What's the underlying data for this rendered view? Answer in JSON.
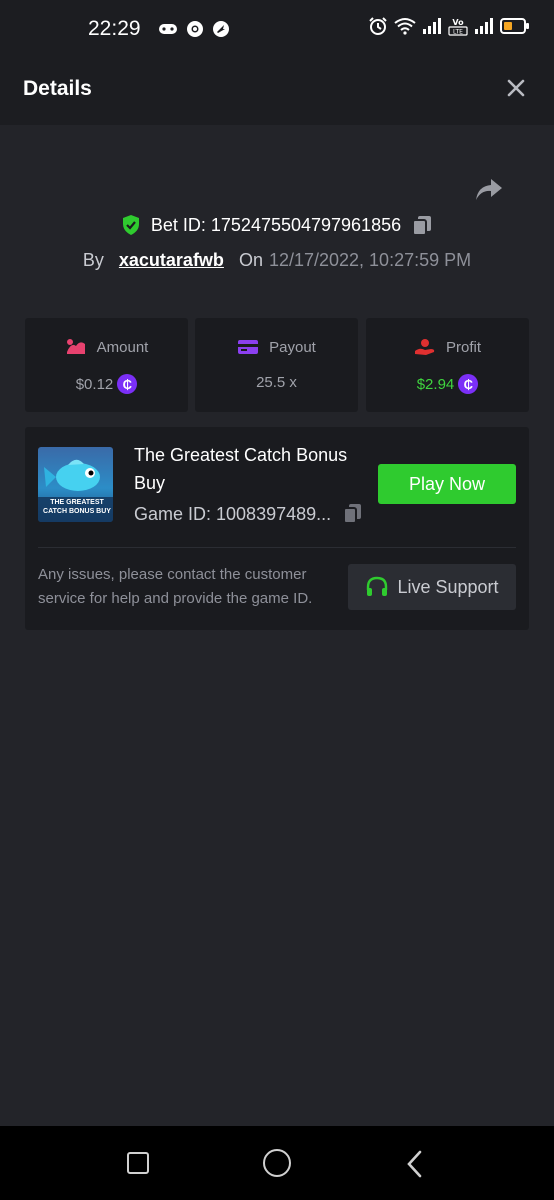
{
  "status_bar": {
    "time": "22:29",
    "left_icons": [
      "gamepad-icon",
      "chrome-icon",
      "app-icon"
    ],
    "right_icons": [
      "alarm-icon",
      "wifi-icon",
      "signal-icon",
      "volte-icon",
      "signal-icon",
      "battery-icon"
    ]
  },
  "header": {
    "title": "Details"
  },
  "bet": {
    "id_label": "Bet ID: 1752475504797961856",
    "by_label": "By",
    "username": "xacutarafwb",
    "on_label": "On",
    "date": "12/17/2022, 10:27:59 PM"
  },
  "stats": {
    "amount": {
      "label": "Amount",
      "value": "$0.12"
    },
    "payout": {
      "label": "Payout",
      "value": "25.5 x"
    },
    "profit": {
      "label": "Profit",
      "value": "$2.94"
    }
  },
  "game": {
    "thumb_text": "THE GREATEST CATCH BONUS BUY",
    "title": "The Greatest Catch Bonus Buy",
    "game_id": "Game ID: 1008397489...",
    "play_label": "Play Now",
    "issue_text": "Any issues, please contact the customer service for help and provide the game ID.",
    "support_label": "Live Support"
  },
  "colors": {
    "background": "#232429",
    "card": "#1a1b1f",
    "play_green": "#2fcb2f",
    "profit_green": "#3fd43f",
    "coin_purple": "#7b2ff7",
    "amount_pink": "#e8426f",
    "payout_purple": "#8b3ff0",
    "profit_red": "#e03030"
  }
}
